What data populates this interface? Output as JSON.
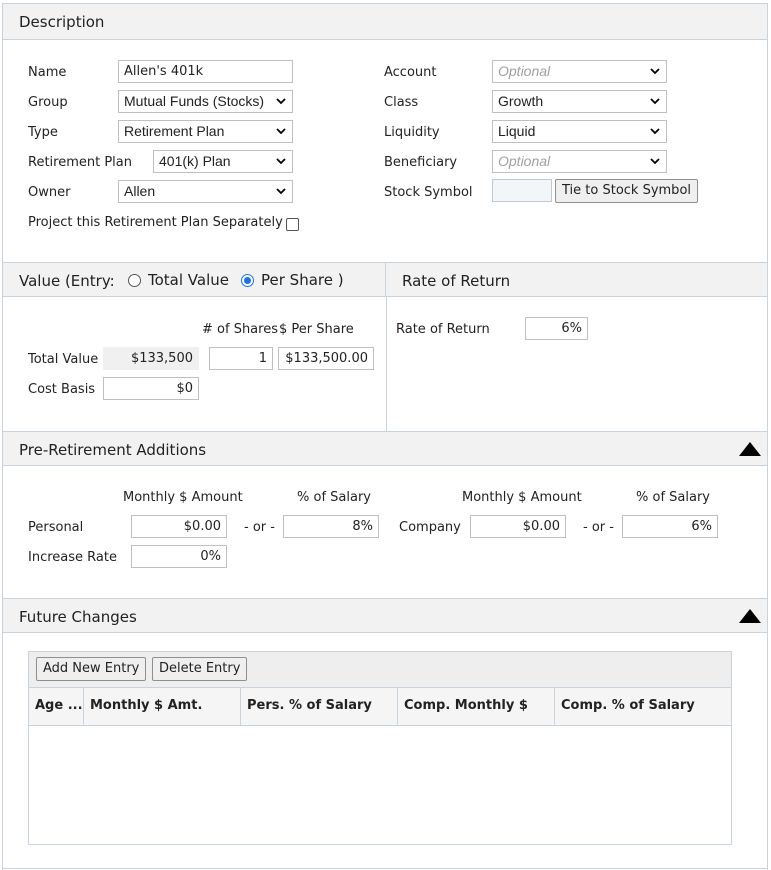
{
  "description": {
    "title": "Description",
    "name_label": "Name",
    "name_value": "Allen's 401k",
    "group_label": "Group",
    "group_value": "Mutual Funds (Stocks)",
    "type_label": "Type",
    "type_value": "Retirement Plan",
    "retirement_plan_label": "Retirement Plan",
    "retirement_plan_value": "401(k) Plan",
    "owner_label": "Owner",
    "owner_value": "Allen",
    "project_separately_label": "Project this Retirement Plan Separately",
    "project_separately_checked": false,
    "account_label": "Account",
    "account_placeholder": "Optional",
    "class_label": "Class",
    "class_value": "Growth",
    "liquidity_label": "Liquidity",
    "liquidity_value": "Liquid",
    "beneficiary_label": "Beneficiary",
    "beneficiary_placeholder": "Optional",
    "stock_symbol_label": "Stock Symbol",
    "stock_symbol_value": "",
    "tie_button": "Tie to Stock Symbol"
  },
  "value": {
    "title_prefix": "Value (Entry:",
    "option_total": "Total Value",
    "option_per_share": "Per Share )",
    "selected_option": "Per Share",
    "shares_header": "# of Shares",
    "per_share_header": "$ Per Share",
    "total_value_label": "Total Value",
    "total_value": "$133,500",
    "shares_value": "1",
    "per_share_value": "$133,500.00",
    "cost_basis_label": "Cost Basis",
    "cost_basis_value": "$0"
  },
  "rate_of_return": {
    "title": "Rate of Return",
    "label": "Rate of Return",
    "value": "6%"
  },
  "pre_retirement": {
    "title": "Pre-Retirement Additions",
    "monthly_header": "Monthly $ Amount",
    "percent_header": "% of Salary",
    "or_text": "- or -",
    "personal_label": "Personal",
    "personal_monthly": "$0.00",
    "personal_percent": "8%",
    "company_label": "Company",
    "company_monthly": "$0.00",
    "company_percent": "6%",
    "increase_rate_label": "Increase Rate",
    "increase_rate_value": "0%"
  },
  "future_changes": {
    "title": "Future Changes",
    "add_button": "Add New Entry",
    "delete_button": "Delete Entry",
    "columns": [
      "Age ...",
      "Monthly $ Amt.",
      "Pers. % of Salary",
      "Comp. Monthly $",
      "Comp. % of Salary"
    ]
  },
  "icons": {
    "dropdown": "chevron-down-icon",
    "collapse": "triangle-up-icon"
  },
  "colors": {
    "header_bg": "#f2f2f2",
    "border": "#c9d3dc",
    "radio_accent": "#1a73e8"
  }
}
